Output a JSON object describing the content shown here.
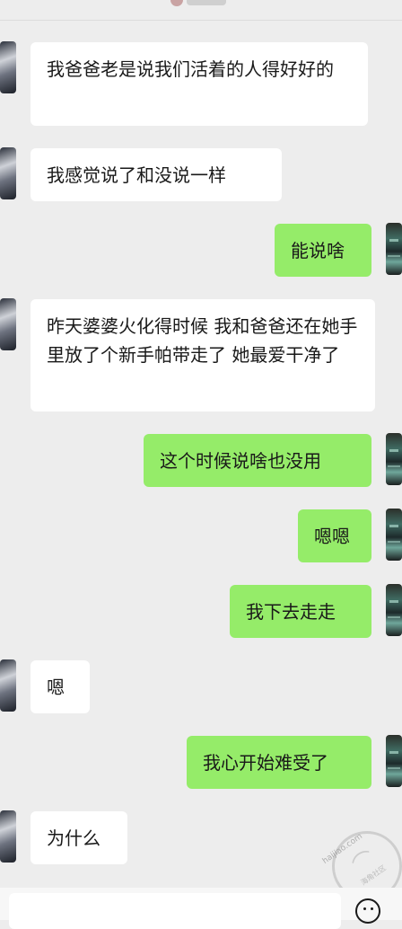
{
  "messages": [
    {
      "side": "left",
      "text": "我爸爸老是说我们活着的人得好好的"
    },
    {
      "side": "left",
      "text": "我感觉说了和没说一样"
    },
    {
      "side": "right",
      "text": "能说啥"
    },
    {
      "side": "left",
      "text": "昨天婆婆火化得时候 我和爸爸还在她手里放了个新手帕带走了 她最爱干净了"
    },
    {
      "side": "right",
      "text": "这个时候说啥也没用"
    },
    {
      "side": "right",
      "text": "嗯嗯"
    },
    {
      "side": "right",
      "text": "我下去走走"
    },
    {
      "side": "left",
      "text": "嗯"
    },
    {
      "side": "right",
      "text": "我心开始难受了"
    },
    {
      "side": "left",
      "text": "为什么"
    }
  ],
  "watermark": {
    "url": "haijiao.com",
    "caption": "海角社区"
  },
  "colors": {
    "background": "#ededed",
    "bubble_self": "#95ec69",
    "bubble_other": "#ffffff",
    "text": "#191919"
  },
  "icons": {
    "emoji": "emoji-icon"
  }
}
